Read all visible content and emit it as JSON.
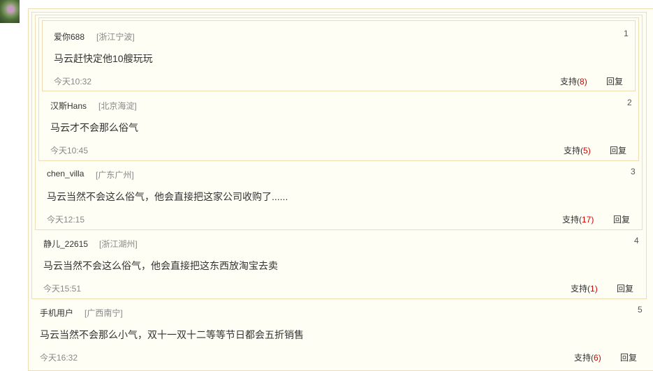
{
  "comments": [
    {
      "user": "爱你688",
      "location": "[浙江宁波]",
      "floor": "1",
      "content": "马云赶快定他10艘玩玩",
      "time": "今天10:32",
      "support_label": "支持(",
      "support_count": "8",
      "support_close": ")",
      "reply_label": "回复"
    },
    {
      "user": "汉斯Hans",
      "location": "[北京海淀]",
      "floor": "2",
      "content": "马云才不会那么俗气",
      "time": "今天10:45",
      "support_label": "支持(",
      "support_count": "5",
      "support_close": ")",
      "reply_label": "回复"
    },
    {
      "user": "chen_villa",
      "location": "[广东广州]",
      "floor": "3",
      "content": "马云当然不会这么俗气，他会直接把这家公司收购了......",
      "time": "今天12:15",
      "support_label": "支持(",
      "support_count": "17",
      "support_close": ")",
      "reply_label": "回复"
    },
    {
      "user": "静儿_22615",
      "location": "[浙江湖州]",
      "floor": "4",
      "content": "马云当然不会这么俗气，他会直接把这东西放淘宝去卖",
      "time": "今天15:51",
      "support_label": "支持(",
      "support_count": "1",
      "support_close": ")",
      "reply_label": "回复"
    },
    {
      "user": "手机用户",
      "location": "[广西南宁]",
      "floor": "5",
      "content": "马云当然不会那么小气，双十一双十二等等节日都会五折销售",
      "time": "今天16:32",
      "support_label": "支持(",
      "support_count": "6",
      "support_close": ")",
      "reply_label": "回复"
    }
  ]
}
